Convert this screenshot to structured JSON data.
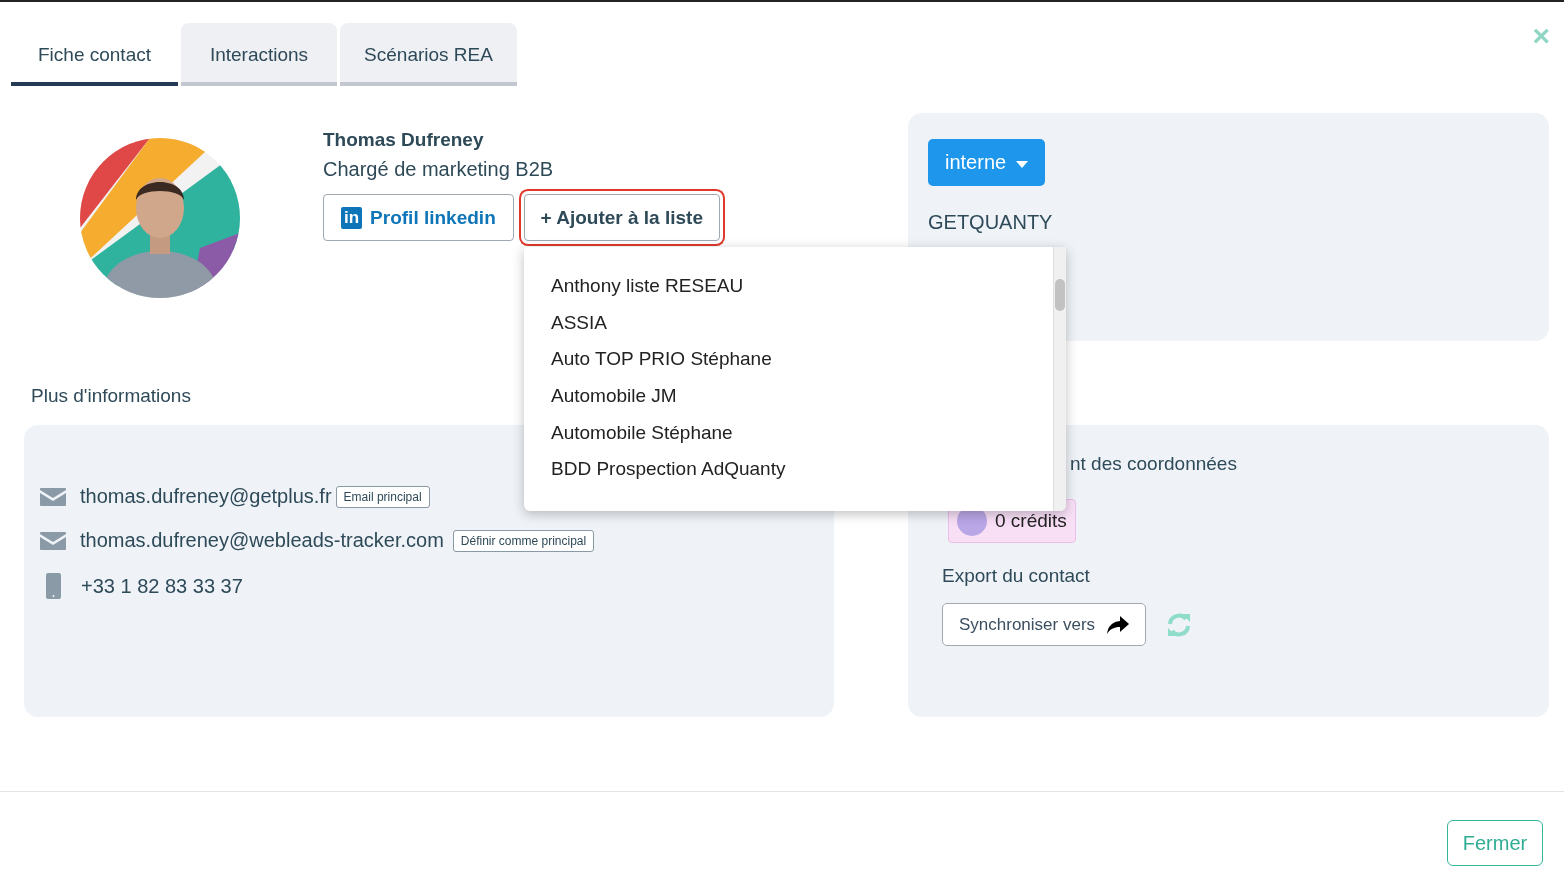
{
  "tabs": [
    {
      "label": "Fiche contact",
      "selected": true
    },
    {
      "label": "Interactions",
      "selected": false
    },
    {
      "label": "Scénarios REA",
      "selected": false
    }
  ],
  "close": "×",
  "contact": {
    "name": "Thomas Dufreney",
    "job_title": "Chargé de marketing B2B",
    "linkedin_badge": "in",
    "linkedin_button": "Profil linkedin",
    "add_to_list_button": "+ Ajouter à la liste"
  },
  "list_dropdown": {
    "items": [
      "Anthony liste RESEAU",
      "ASSIA",
      "Auto TOP PRIO Stéphane",
      "Automobile JM",
      "Automobile Stéphane",
      "BDD Prospection AdQuanty"
    ]
  },
  "more_info": {
    "title": "Plus d'informations",
    "rows": [
      {
        "kind": "email",
        "value": "thomas.dufreney@getplus.fr",
        "tag": "Email principal"
      },
      {
        "kind": "email",
        "value": "thomas.dufreney@webleads-tracker.com",
        "tag": "Définir comme principal"
      },
      {
        "kind": "phone",
        "value": "+33 1 82 83 33 37"
      }
    ]
  },
  "company": {
    "type_button": "interne",
    "name": "GETQUANTY"
  },
  "enrichment": {
    "title": "nt des coordonnées",
    "credits": "0 crédits"
  },
  "export": {
    "title": "Export du contact",
    "sync_button": "Synchroniser vers"
  },
  "footer": {
    "close_button": "Fermer"
  }
}
